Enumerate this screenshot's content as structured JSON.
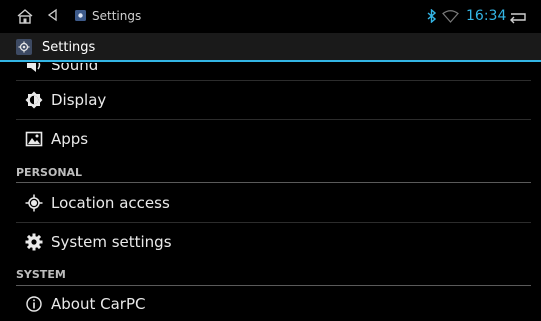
{
  "statusbar": {
    "title": "Settings",
    "time": "16:34",
    "icons": [
      "home-icon",
      "back-icon",
      "settings-app-icon",
      "bluetooth-icon",
      "wifi-icon",
      "return-icon"
    ]
  },
  "actionbar": {
    "title": "Settings",
    "icon": "settings-gear-icon"
  },
  "list": {
    "partial_item": "Sound",
    "items": [
      {
        "label": "Display",
        "icon": "display-icon"
      },
      {
        "label": "Apps",
        "icon": "apps-icon"
      }
    ],
    "personal_header": "PERSONAL",
    "personal_items": [
      {
        "label": "Location access",
        "icon": "location-icon"
      },
      {
        "label": "System settings",
        "icon": "system-settings-icon"
      }
    ],
    "system_header": "SYSTEM",
    "system_items": [
      {
        "label": "About CarPC",
        "icon": "info-icon"
      }
    ]
  },
  "colors": {
    "accent": "#33b5e5",
    "background": "#000000",
    "actionbar": "#1a1a1a"
  }
}
